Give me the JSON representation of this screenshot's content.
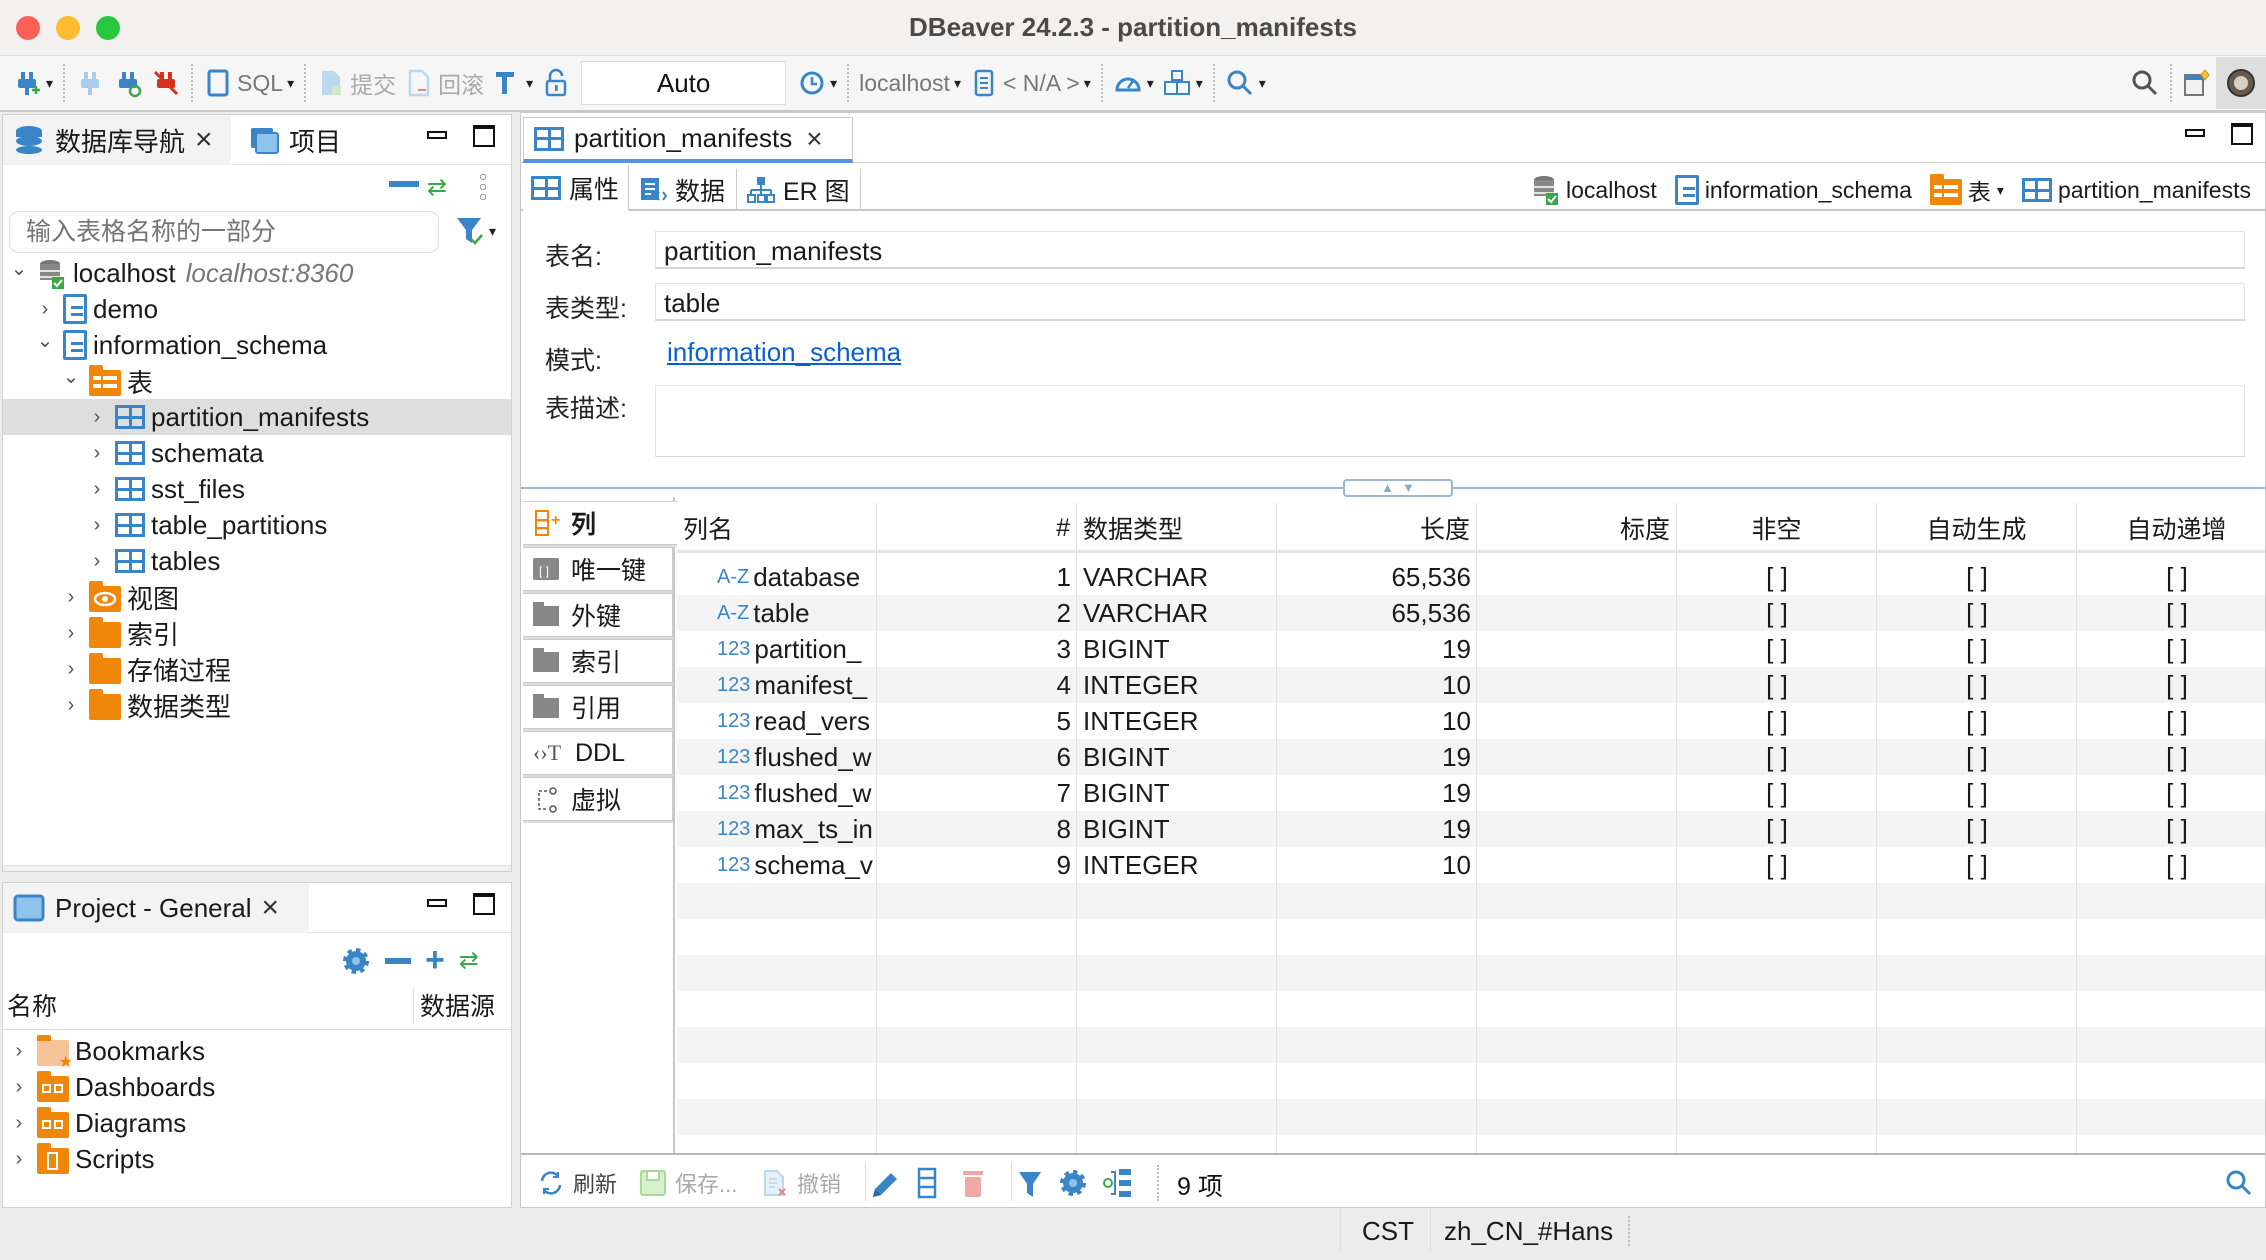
{
  "window": {
    "title": "DBeaver 24.2.3 - partition_manifests"
  },
  "toolbar": {
    "sql_label": "SQL",
    "commit_label": "提交",
    "rollback_label": "回滚",
    "transaction_mode": "Auto",
    "datasource": "localhost",
    "schema": "< N/A >"
  },
  "navigator": {
    "tab_label": "数据库导航",
    "projects_tab_label": "项目",
    "filter_placeholder": "输入表格名称的一部分",
    "tree": [
      {
        "label": "localhost",
        "detail": "localhost:8360",
        "level": 0,
        "expanded": true,
        "icon": "database-connected-icon"
      },
      {
        "label": "demo",
        "level": 1,
        "expanded": false,
        "icon": "schema-icon"
      },
      {
        "label": "information_schema",
        "level": 1,
        "expanded": true,
        "icon": "schema-icon"
      },
      {
        "label": "表",
        "level": 2,
        "expanded": true,
        "icon": "tables-folder-icon"
      },
      {
        "label": "partition_manifests",
        "level": 3,
        "expanded": false,
        "icon": "table-icon",
        "selected": true
      },
      {
        "label": "schemata",
        "level": 3,
        "expanded": false,
        "icon": "table-icon"
      },
      {
        "label": "sst_files",
        "level": 3,
        "expanded": false,
        "icon": "table-icon"
      },
      {
        "label": "table_partitions",
        "level": 3,
        "expanded": false,
        "icon": "table-icon"
      },
      {
        "label": "tables",
        "level": 3,
        "expanded": false,
        "icon": "table-icon"
      },
      {
        "label": "视图",
        "level": 2,
        "expanded": false,
        "icon": "views-folder-icon"
      },
      {
        "label": "索引",
        "level": 2,
        "expanded": false,
        "icon": "folder-icon"
      },
      {
        "label": "存储过程",
        "level": 2,
        "expanded": false,
        "icon": "folder-icon"
      },
      {
        "label": "数据类型",
        "level": 2,
        "expanded": false,
        "icon": "folder-icon"
      }
    ]
  },
  "project": {
    "tab_label": "Project - General",
    "col_name": "名称",
    "col_datasource": "数据源",
    "items": [
      {
        "label": "Bookmarks",
        "icon": "bookmarks-folder-icon"
      },
      {
        "label": "Dashboards",
        "icon": "dashboards-folder-icon"
      },
      {
        "label": "Diagrams",
        "icon": "diagrams-folder-icon"
      },
      {
        "label": "Scripts",
        "icon": "scripts-folder-icon"
      }
    ]
  },
  "editor": {
    "tab_label": "partition_manifests",
    "subtabs": [
      "属性",
      "数据",
      "ER 图"
    ],
    "breadcrumb": {
      "datasource": "localhost",
      "schema": "information_schema",
      "folder": "表",
      "table": "partition_manifests"
    },
    "form": {
      "name_label": "表名:",
      "name_value": "partition_manifests",
      "type_label": "表类型:",
      "type_value": "table",
      "schema_label": "模式:",
      "schema_value": "information_schema",
      "desc_label": "表描述:",
      "desc_value": ""
    },
    "side_tabs": [
      "列",
      "唯一键",
      "外键",
      "索引",
      "引用",
      "DDL",
      "虚拟"
    ],
    "columns_header": [
      "列名",
      "#",
      "数据类型",
      "长度",
      "标度",
      "非空",
      "自动生成",
      "自动递增"
    ],
    "columns": [
      {
        "type_icon": "A-Z",
        "name": "database",
        "num": "1",
        "dtype": "VARCHAR",
        "length": "65,536",
        "scale": "",
        "notnull": "[ ]",
        "autogen": "[ ]",
        "autoinc": "[ ]"
      },
      {
        "type_icon": "A-Z",
        "name": "table",
        "num": "2",
        "dtype": "VARCHAR",
        "length": "65,536",
        "scale": "",
        "notnull": "[ ]",
        "autogen": "[ ]",
        "autoinc": "[ ]"
      },
      {
        "type_icon": "123",
        "name": "partition_",
        "num": "3",
        "dtype": "BIGINT",
        "length": "19",
        "scale": "",
        "notnull": "[ ]",
        "autogen": "[ ]",
        "autoinc": "[ ]"
      },
      {
        "type_icon": "123",
        "name": "manifest_",
        "num": "4",
        "dtype": "INTEGER",
        "length": "10",
        "scale": "",
        "notnull": "[ ]",
        "autogen": "[ ]",
        "autoinc": "[ ]"
      },
      {
        "type_icon": "123",
        "name": "read_vers",
        "num": "5",
        "dtype": "INTEGER",
        "length": "10",
        "scale": "",
        "notnull": "[ ]",
        "autogen": "[ ]",
        "autoinc": "[ ]"
      },
      {
        "type_icon": "123",
        "name": "flushed_w",
        "num": "6",
        "dtype": "BIGINT",
        "length": "19",
        "scale": "",
        "notnull": "[ ]",
        "autogen": "[ ]",
        "autoinc": "[ ]"
      },
      {
        "type_icon": "123",
        "name": "flushed_w",
        "num": "7",
        "dtype": "BIGINT",
        "length": "19",
        "scale": "",
        "notnull": "[ ]",
        "autogen": "[ ]",
        "autoinc": "[ ]"
      },
      {
        "type_icon": "123",
        "name": "max_ts_in",
        "num": "8",
        "dtype": "BIGINT",
        "length": "19",
        "scale": "",
        "notnull": "[ ]",
        "autogen": "[ ]",
        "autoinc": "[ ]"
      },
      {
        "type_icon": "123",
        "name": "schema_v",
        "num": "9",
        "dtype": "INTEGER",
        "length": "10",
        "scale": "",
        "notnull": "[ ]",
        "autogen": "[ ]",
        "autoinc": "[ ]"
      }
    ],
    "bottom": {
      "refresh": "刷新",
      "save": "保存...",
      "cancel": "撤销",
      "count": "9 项"
    }
  },
  "statusbar": {
    "timezone": "CST",
    "locale": "zh_CN_#Hans"
  }
}
